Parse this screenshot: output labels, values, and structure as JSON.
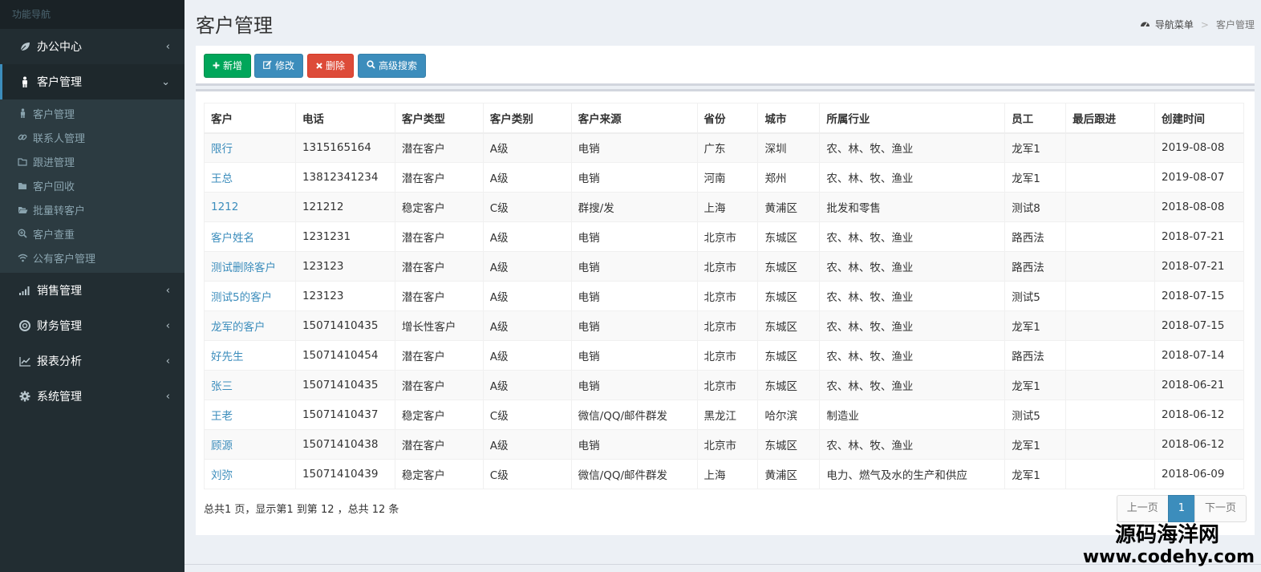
{
  "sidebar": {
    "header": "功能导航",
    "office": "办公中心",
    "customer": "客户管理",
    "sub": [
      "客户管理",
      "联系人管理",
      "跟进管理",
      "客户回收",
      "批量转客户",
      "客户查重",
      "公有客户管理"
    ],
    "sales": "销售管理",
    "finance": "财务管理",
    "report": "报表分析",
    "system": "系统管理"
  },
  "header": {
    "title": "客户管理",
    "crumb_home": "导航菜单",
    "crumb_sep": ">",
    "crumb_current": "客户管理"
  },
  "toolbar": {
    "add": "新增",
    "edit": "修改",
    "delete": "删除",
    "search": "高级搜索"
  },
  "table": {
    "columns": [
      "客户",
      "电话",
      "客户类型",
      "客户类别",
      "客户来源",
      "省份",
      "城市",
      "所属行业",
      "员工",
      "最后跟进",
      "创建时间"
    ],
    "rows": [
      [
        "限行",
        "1315165164",
        "潜在客户",
        "A级",
        "电销",
        "广东",
        "深圳",
        "农、林、牧、渔业",
        "龙军1",
        "",
        "2019-08-08"
      ],
      [
        "王总",
        "13812341234",
        "潜在客户",
        "A级",
        "电销",
        "河南",
        "郑州",
        "农、林、牧、渔业",
        "龙军1",
        "",
        "2019-08-07"
      ],
      [
        "1212",
        "121212",
        "稳定客户",
        "C级",
        "群搜/发",
        "上海",
        "黄浦区",
        "批发和零售",
        "测试8",
        "",
        "2018-08-08"
      ],
      [
        "客户姓名",
        "1231231",
        "潜在客户",
        "A级",
        "电销",
        "北京市",
        "东城区",
        "农、林、牧、渔业",
        "路西法",
        "",
        "2018-07-21"
      ],
      [
        "测试删除客户",
        "123123",
        "潜在客户",
        "A级",
        "电销",
        "北京市",
        "东城区",
        "农、林、牧、渔业",
        "路西法",
        "",
        "2018-07-21"
      ],
      [
        "测试5的客户",
        "123123",
        "潜在客户",
        "A级",
        "电销",
        "北京市",
        "东城区",
        "农、林、牧、渔业",
        "测试5",
        "",
        "2018-07-15"
      ],
      [
        "龙军的客户",
        "15071410435",
        "增长性客户",
        "A级",
        "电销",
        "北京市",
        "东城区",
        "农、林、牧、渔业",
        "龙军1",
        "",
        "2018-07-15"
      ],
      [
        "好先生",
        "15071410454",
        "潜在客户",
        "A级",
        "电销",
        "北京市",
        "东城区",
        "农、林、牧、渔业",
        "路西法",
        "",
        "2018-07-14"
      ],
      [
        "张三",
        "15071410435",
        "潜在客户",
        "A级",
        "电销",
        "北京市",
        "东城区",
        "农、林、牧、渔业",
        "龙军1",
        "",
        "2018-06-21"
      ],
      [
        "王老",
        "15071410437",
        "稳定客户",
        "C级",
        "微信/QQ/邮件群发",
        "黑龙江",
        "哈尔滨",
        "制造业",
        "测试5",
        "",
        "2018-06-12"
      ],
      [
        "顾源",
        "15071410438",
        "潜在客户",
        "A级",
        "电销",
        "北京市",
        "东城区",
        "农、林、牧、渔业",
        "龙军1",
        "",
        "2018-06-12"
      ],
      [
        "刘弥",
        "15071410439",
        "稳定客户",
        "C级",
        "微信/QQ/邮件群发",
        "上海",
        "黄浦区",
        "电力、燃气及水的生产和供应",
        "龙军1",
        "",
        "2018-06-09"
      ]
    ]
  },
  "summary": "总共1 页，显示第1 到第 12 ，总共 12 条",
  "pager": {
    "prev": "上一页",
    "current": "1",
    "next": "下一页"
  },
  "watermark": {
    "line1": "源码海洋网",
    "line2": "www.codehy.com"
  }
}
